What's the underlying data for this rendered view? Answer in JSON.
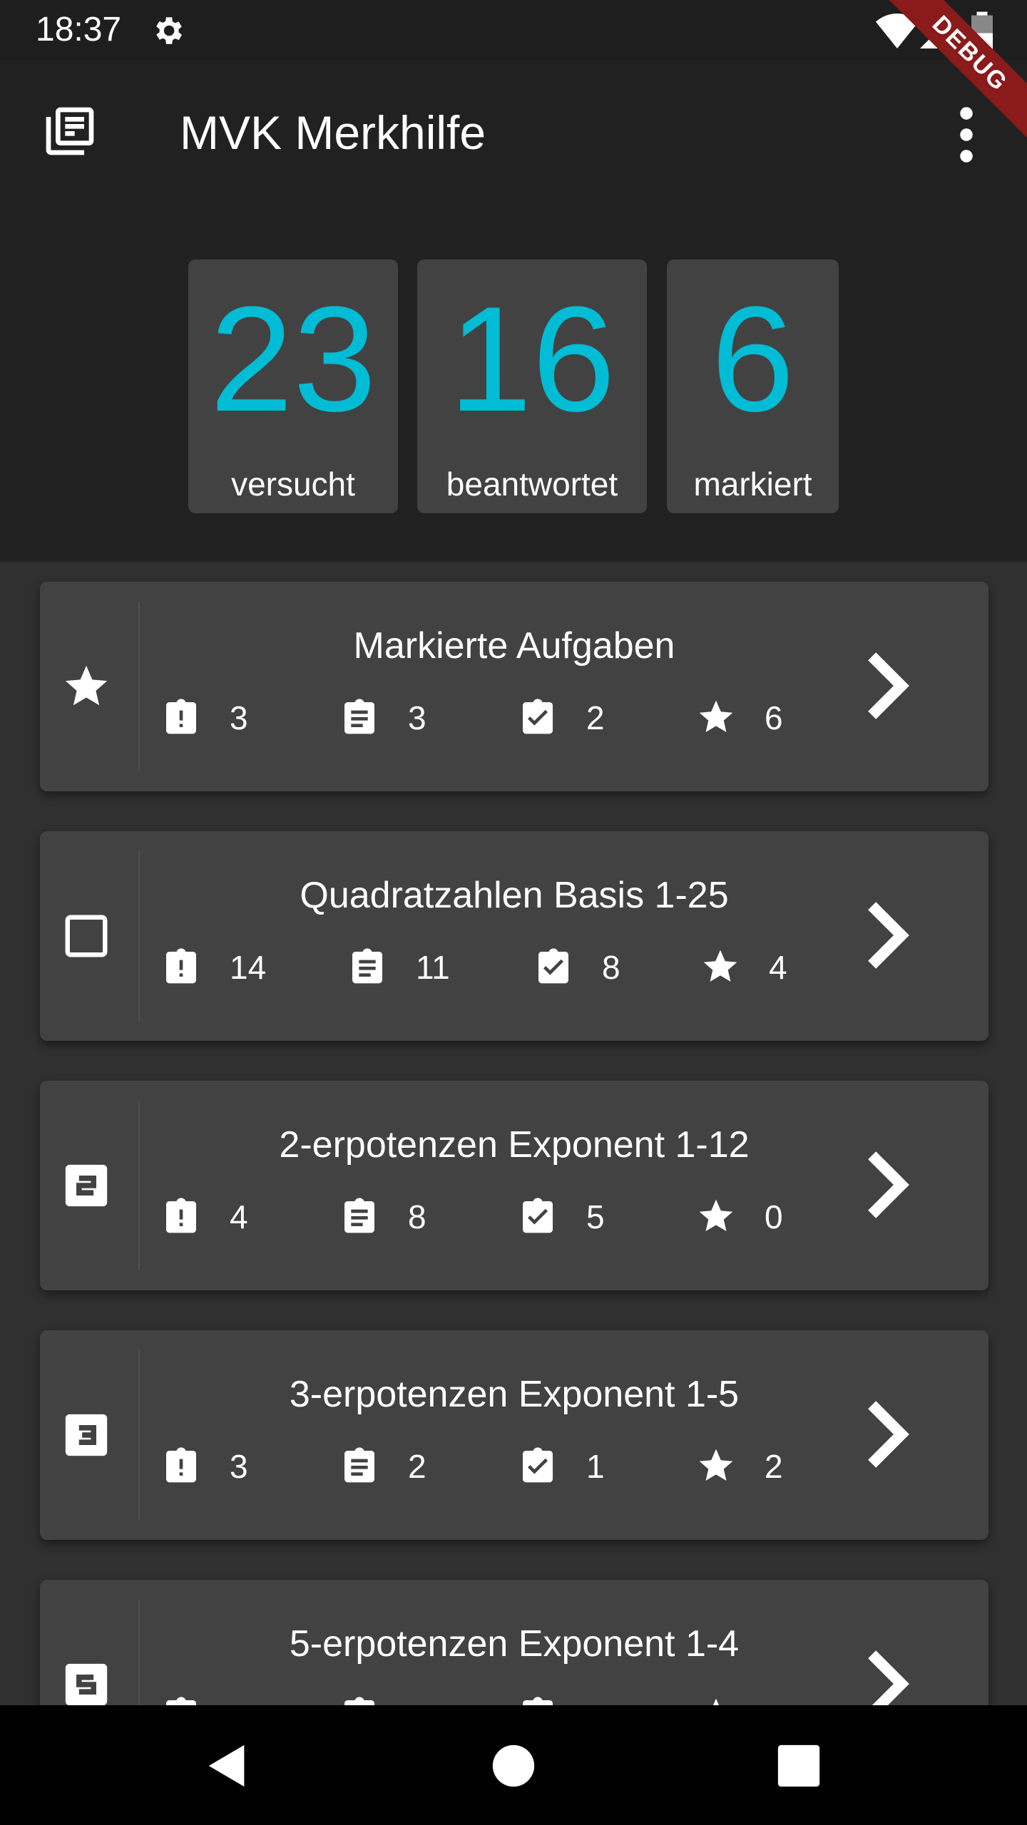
{
  "status": {
    "time": "18:37"
  },
  "debug_label": "DEBUG",
  "appbar": {
    "title": "MVK Merkhilfe"
  },
  "stats": [
    {
      "value": "23",
      "label": "versucht"
    },
    {
      "value": "16",
      "label": "beantwortet"
    },
    {
      "value": "6",
      "label": "markiert"
    }
  ],
  "items": [
    {
      "title": "Markierte Aufgaben",
      "lead_icon": "star-icon",
      "open": "3",
      "notes": "3",
      "done": "2",
      "starred": "6"
    },
    {
      "title": "Quadratzahlen Basis 1-25",
      "lead_icon": "square-outline-icon",
      "open": "14",
      "notes": "11",
      "done": "8",
      "starred": "4"
    },
    {
      "title": "2-erpotenzen Exponent 1-12",
      "lead_icon": "number-2-icon",
      "open": "4",
      "notes": "8",
      "done": "5",
      "starred": "0"
    },
    {
      "title": "3-erpotenzen Exponent 1-5",
      "lead_icon": "number-3-icon",
      "open": "3",
      "notes": "2",
      "done": "1",
      "starred": "2"
    },
    {
      "title": "5-erpotenzen Exponent 1-4",
      "lead_icon": "number-5-icon",
      "open": "",
      "notes": "",
      "done": "",
      "starred": ""
    }
  ],
  "colors": {
    "accent": "#00bcd4",
    "card": "#424242",
    "background": "#303030",
    "appbar": "#212121"
  }
}
